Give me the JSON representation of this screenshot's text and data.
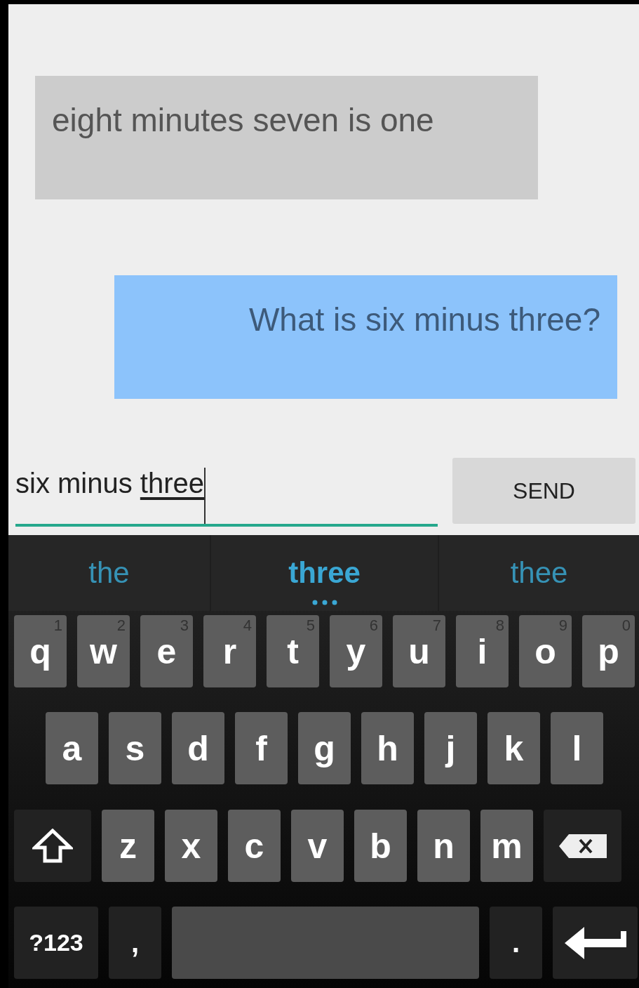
{
  "messages": [
    {
      "kind": "received",
      "text": "eight minutes seven is one"
    },
    {
      "kind": "sent",
      "text": "What is six minus three?"
    }
  ],
  "input": {
    "text": "six minus ",
    "composing": "three"
  },
  "send_button": "SEND",
  "suggestions": [
    {
      "label": "the",
      "selected": false
    },
    {
      "label": "three",
      "selected": true
    },
    {
      "label": "thee",
      "selected": false
    }
  ],
  "keyboard": [
    [
      {
        "kind": "letter",
        "label": "q",
        "hint": "1"
      },
      {
        "kind": "letter",
        "label": "w",
        "hint": "2"
      },
      {
        "kind": "letter",
        "label": "e",
        "hint": "3"
      },
      {
        "kind": "letter",
        "label": "r",
        "hint": "4"
      },
      {
        "kind": "letter",
        "label": "t",
        "hint": "5"
      },
      {
        "kind": "letter",
        "label": "y",
        "hint": "6"
      },
      {
        "kind": "letter",
        "label": "u",
        "hint": "7"
      },
      {
        "kind": "letter",
        "label": "i",
        "hint": "8"
      },
      {
        "kind": "letter",
        "label": "o",
        "hint": "9"
      },
      {
        "kind": "letter",
        "label": "p",
        "hint": "0"
      }
    ],
    [
      {
        "kind": "letter",
        "label": "a"
      },
      {
        "kind": "letter",
        "label": "s"
      },
      {
        "kind": "letter",
        "label": "d"
      },
      {
        "kind": "letter",
        "label": "f"
      },
      {
        "kind": "letter",
        "label": "g"
      },
      {
        "kind": "letter",
        "label": "h"
      },
      {
        "kind": "letter",
        "label": "j"
      },
      {
        "kind": "letter",
        "label": "k"
      },
      {
        "kind": "letter",
        "label": "l"
      }
    ],
    [
      {
        "kind": "shift"
      },
      {
        "kind": "letter",
        "label": "z"
      },
      {
        "kind": "letter",
        "label": "x"
      },
      {
        "kind": "letter",
        "label": "c"
      },
      {
        "kind": "letter",
        "label": "v"
      },
      {
        "kind": "letter",
        "label": "b"
      },
      {
        "kind": "letter",
        "label": "n"
      },
      {
        "kind": "letter",
        "label": "m"
      },
      {
        "kind": "backspace"
      }
    ],
    [
      {
        "kind": "symbols",
        "label": "?123"
      },
      {
        "kind": "punct",
        "label": ","
      },
      {
        "kind": "space"
      },
      {
        "kind": "punct",
        "label": "."
      },
      {
        "kind": "enter"
      }
    ]
  ]
}
